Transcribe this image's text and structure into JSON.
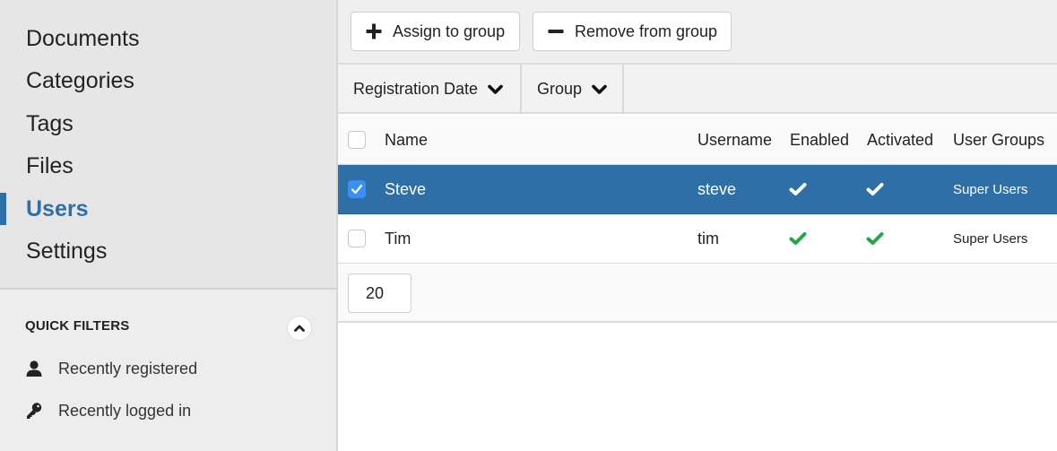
{
  "sidebar": {
    "nav": [
      {
        "label": "Documents",
        "active": false
      },
      {
        "label": "Categories",
        "active": false
      },
      {
        "label": "Tags",
        "active": false
      },
      {
        "label": "Files",
        "active": false
      },
      {
        "label": "Users",
        "active": true
      },
      {
        "label": "Settings",
        "active": false
      }
    ],
    "quick_filters": {
      "title": "QUICK FILTERS",
      "toggle_icon": "chevron-up-icon",
      "items": [
        {
          "label": "Recently registered",
          "icon": "user-icon"
        },
        {
          "label": "Recently logged in",
          "icon": "key-icon"
        }
      ]
    }
  },
  "toolbar": {
    "assign_label": "Assign to group",
    "remove_label": "Remove from group"
  },
  "filters": [
    {
      "label": "Registration Date",
      "icon": "chevron-down-icon"
    },
    {
      "label": "Group",
      "icon": "chevron-down-icon"
    }
  ],
  "table": {
    "columns": [
      "Name",
      "Username",
      "Enabled",
      "Activated",
      "User Groups"
    ],
    "rows": [
      {
        "name": "Steve",
        "username": "steve",
        "enabled": true,
        "activated": true,
        "groups": "Super Users",
        "selected": true
      },
      {
        "name": "Tim",
        "username": "tim",
        "enabled": true,
        "activated": true,
        "groups": "Super Users",
        "selected": false
      }
    ]
  },
  "pagination": {
    "page_size": "20"
  },
  "colors": {
    "accent": "#2f6fa8",
    "checkbox_checked": "#3d8ef2",
    "check_green": "#27a744"
  }
}
